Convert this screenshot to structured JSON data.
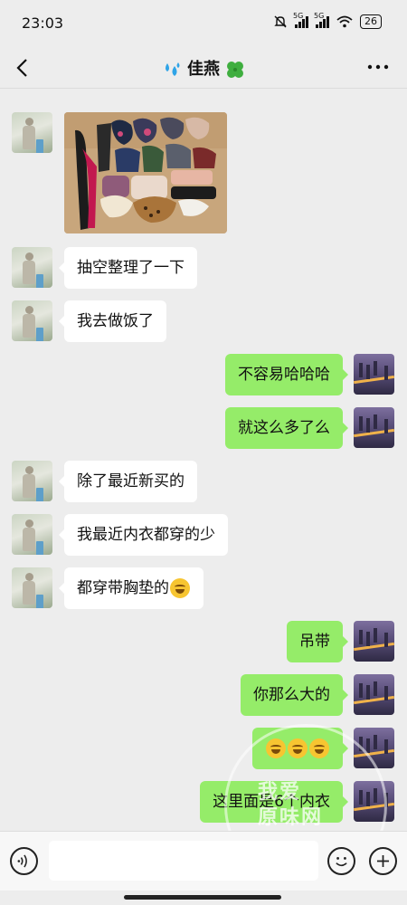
{
  "status_bar": {
    "time": "23:03",
    "signal1": "5G",
    "signal2": "5G",
    "battery": "26"
  },
  "header": {
    "title": "佳燕",
    "title_prefix_icon": "water-drops-icon",
    "title_suffix_icon": "four-leaf-clover-icon"
  },
  "messages": [
    {
      "side": "left",
      "type": "image",
      "content": "clothing-photo"
    },
    {
      "side": "left",
      "type": "text",
      "text": "抽空整理了一下"
    },
    {
      "side": "left",
      "type": "text",
      "text": "我去做饭了"
    },
    {
      "side": "right",
      "type": "text",
      "text": "不容易哈哈哈"
    },
    {
      "side": "right",
      "type": "text",
      "text": "就这么多了么"
    },
    {
      "side": "left",
      "type": "text",
      "text": "除了最近新买的"
    },
    {
      "side": "left",
      "type": "text",
      "text": "我最近内衣都穿的少"
    },
    {
      "side": "left",
      "type": "text",
      "text": "都穿带胸垫的",
      "emoji": "rolling-laughing-emoji"
    },
    {
      "side": "right",
      "type": "text",
      "text": "吊带"
    },
    {
      "side": "right",
      "type": "text",
      "text": "你那么大的"
    },
    {
      "side": "right",
      "type": "emoji",
      "emoji": [
        "tears-of-joy-emoji",
        "tears-of-joy-emoji",
        "tears-of-joy-emoji"
      ]
    },
    {
      "side": "right",
      "type": "text",
      "text": "这里面是6个内衣"
    }
  ],
  "watermark": {
    "line1": "我爱",
    "line2": "原味网"
  },
  "colors": {
    "background": "#ededed",
    "bubble_left": "#ffffff",
    "bubble_right": "#95ec69",
    "input_bar": "#f7f7f7"
  }
}
